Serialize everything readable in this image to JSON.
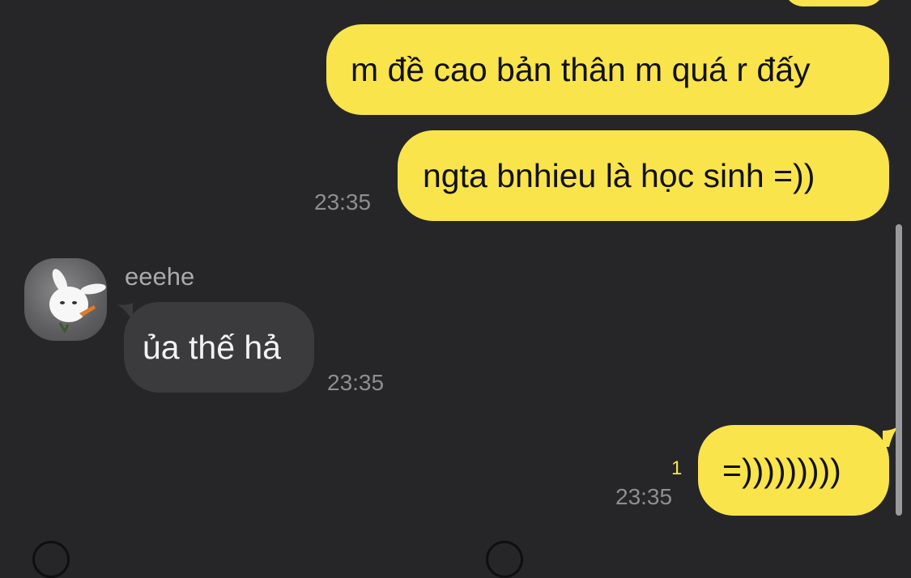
{
  "messages": [
    {
      "text": "m đề cao bản thân m quá r đấy"
    },
    {
      "text": "ngta bnhieu là học sinh =))",
      "time": "23:35"
    },
    {
      "sender": "eeehe",
      "text": "ủa thế hả",
      "time": "23:35"
    },
    {
      "text": "=)))))))))",
      "time": "23:35",
      "unread": "1"
    }
  ],
  "colors": {
    "background": "#262628",
    "outgoing_bubble": "#f9e44b",
    "incoming_bubble": "#3b3b3d",
    "timestamp": "#8e8e90",
    "unread_count": "#f9e44b"
  }
}
